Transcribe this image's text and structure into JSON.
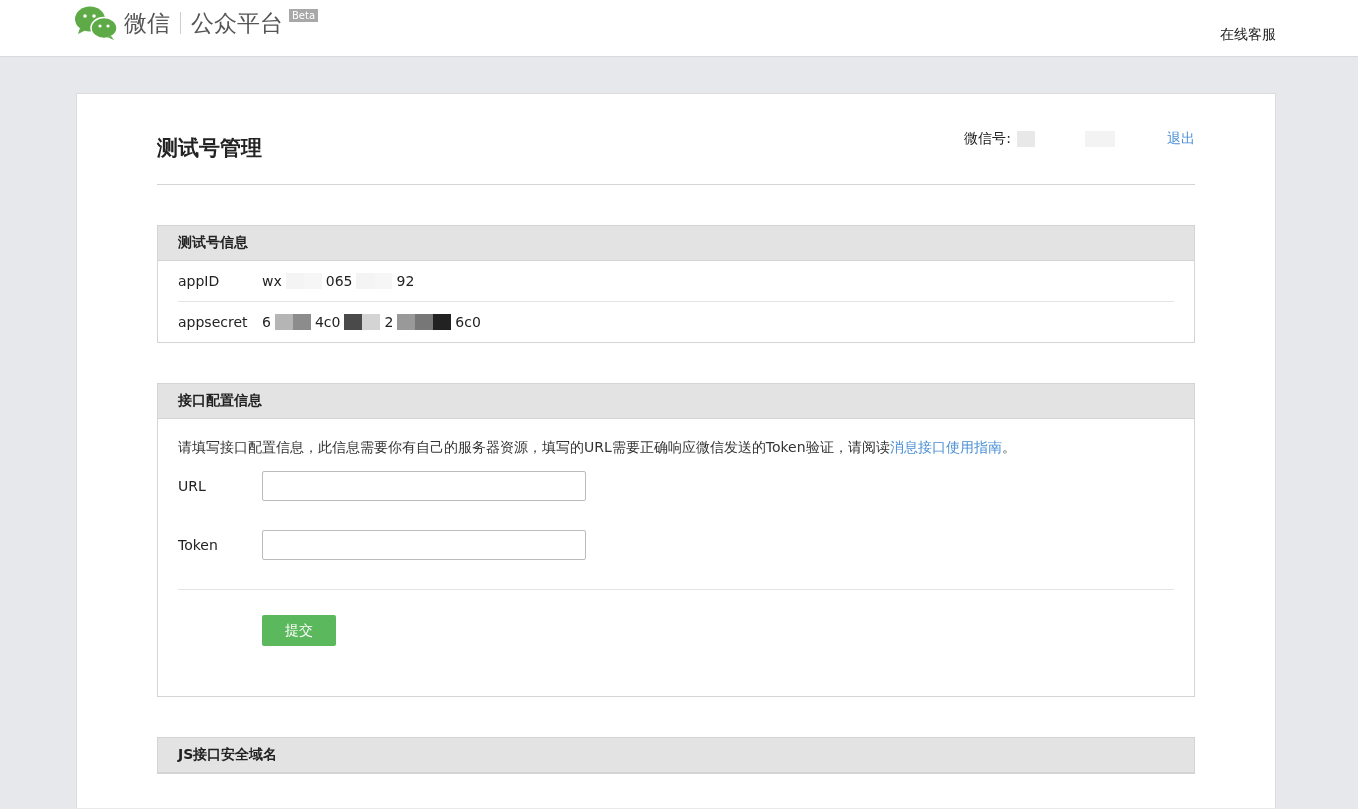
{
  "header": {
    "brand": "微信",
    "product": "公众平台",
    "badge": "Beta",
    "service_link": "在线客服"
  },
  "page": {
    "title": "测试号管理",
    "account_label": "微信号:",
    "logout": "退出"
  },
  "test_account": {
    "title": "测试号信息",
    "rows": [
      {
        "label": "appID",
        "fragments": [
          "wx",
          "065",
          "92"
        ]
      },
      {
        "label": "appsecret",
        "fragments": [
          "6",
          "4c0",
          "2",
          "6c0"
        ]
      }
    ]
  },
  "interface_config": {
    "title": "接口配置信息",
    "description": "请填写接口配置信息，此信息需要你有自己的服务器资源，填写的URL需要正确响应微信发送的Token验证，请阅读",
    "guide_link": "消息接口使用指南",
    "description_end": "。",
    "fields": [
      {
        "label": "URL"
      },
      {
        "label": "Token"
      }
    ],
    "submit": "提交"
  },
  "js_domain": {
    "title": "JS接口安全域名"
  }
}
